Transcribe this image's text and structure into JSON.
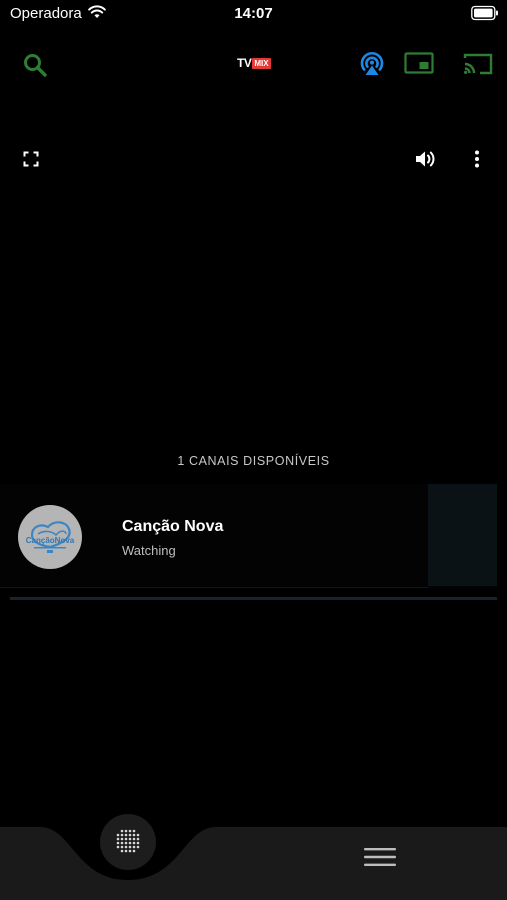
{
  "status_bar": {
    "carrier": "Operadora",
    "time": "14:07"
  },
  "toolbar": {
    "logo_tv": "TV",
    "logo_mix": "MIX",
    "icons": [
      "search-icon",
      "airplay-icon",
      "picture-in-picture-icon",
      "cast-icon"
    ]
  },
  "player": {
    "icons": [
      "fullscreen-icon",
      "volume-icon",
      "more-vertical-icon"
    ]
  },
  "channels": {
    "count_label": "1 CANAIS DISPONÍVEIS",
    "items": [
      {
        "name": "Canção Nova",
        "status": "Watching",
        "logo_text": "CançãoNova"
      }
    ]
  },
  "bottom_bar": {
    "icons": [
      "grid-dots-icon",
      "menu-icon"
    ]
  },
  "colors": {
    "background": "#000000",
    "accent_green": "#2e7d32",
    "airplay_blue": "#1e88e5",
    "logo_red": "#e53935"
  }
}
